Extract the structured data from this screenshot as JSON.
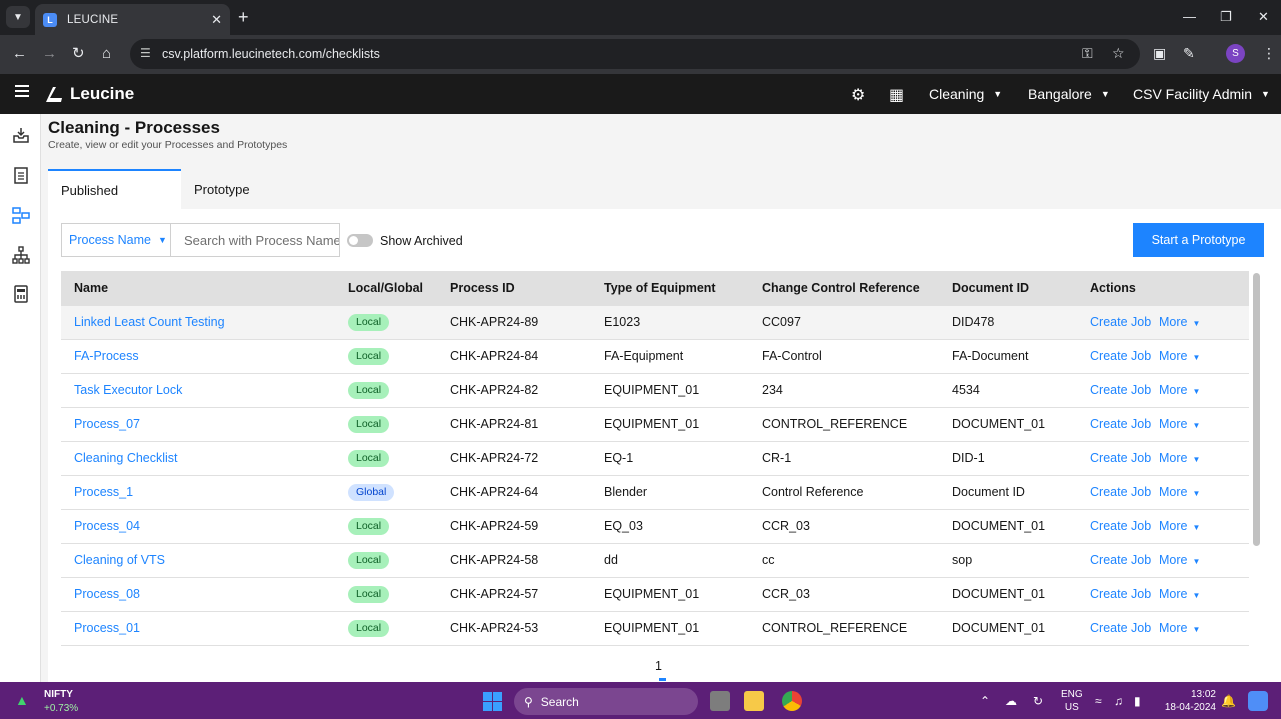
{
  "browser": {
    "tab_title": "LEUCINE",
    "url": "csv.platform.leucinetech.com/checklists",
    "profile_initial": "S"
  },
  "header": {
    "brand": "Leucine",
    "use_case": "Cleaning",
    "site": "Bangalore",
    "role": "CSV Facility Admin"
  },
  "page": {
    "title": "Cleaning - Processes",
    "subtitle": "Create, view or edit your Processes and Prototypes",
    "tabs": [
      {
        "label": "Published",
        "active": true
      },
      {
        "label": "Prototype",
        "active": false
      }
    ]
  },
  "filters": {
    "field_label": "Process Name",
    "search_placeholder": "Search with Process Name",
    "show_archived_label": "Show Archived",
    "show_archived": false,
    "primary_button": "Start a Prototype"
  },
  "table": {
    "columns": [
      "Name",
      "Local/Global",
      "Process ID",
      "Type of Equipment",
      "Change Control Reference",
      "Document ID",
      "Actions"
    ],
    "action_label": "Create Job",
    "more_label": "More",
    "rows": [
      {
        "name": "Linked Least Count Testing",
        "scope": "Local",
        "process_id": "CHK-APR24-89",
        "equipment": "E1023",
        "change_control": "CC097",
        "document_id": "DID478"
      },
      {
        "name": "FA-Process",
        "scope": "Local",
        "process_id": "CHK-APR24-84",
        "equipment": "FA-Equipment",
        "change_control": "FA-Control",
        "document_id": "FA-Document"
      },
      {
        "name": "Task Executor Lock",
        "scope": "Local",
        "process_id": "CHK-APR24-82",
        "equipment": "EQUIPMENT_01",
        "change_control": "234",
        "document_id": "4534"
      },
      {
        "name": "Process_07",
        "scope": "Local",
        "process_id": "CHK-APR24-81",
        "equipment": "EQUIPMENT_01",
        "change_control": "CONTROL_REFERENCE",
        "document_id": "DOCUMENT_01"
      },
      {
        "name": "Cleaning Checklist",
        "scope": "Local",
        "process_id": "CHK-APR24-72",
        "equipment": "EQ-1",
        "change_control": "CR-1",
        "document_id": "DID-1"
      },
      {
        "name": "Process_1",
        "scope": "Global",
        "process_id": "CHK-APR24-64",
        "equipment": "Blender",
        "change_control": "Control Reference",
        "document_id": "Document ID"
      },
      {
        "name": "Process_04",
        "scope": "Local",
        "process_id": "CHK-APR24-59",
        "equipment": "EQ_03",
        "change_control": "CCR_03",
        "document_id": "DOCUMENT_01"
      },
      {
        "name": "Cleaning of VTS",
        "scope": "Local",
        "process_id": "CHK-APR24-58",
        "equipment": "dd",
        "change_control": "cc",
        "document_id": "sop"
      },
      {
        "name": "Process_08",
        "scope": "Local",
        "process_id": "CHK-APR24-57",
        "equipment": "EQUIPMENT_01",
        "change_control": "CCR_03",
        "document_id": "DOCUMENT_01"
      },
      {
        "name": "Process_01",
        "scope": "Local",
        "process_id": "CHK-APR24-53",
        "equipment": "EQUIPMENT_01",
        "change_control": "CONTROL_REFERENCE",
        "document_id": "DOCUMENT_01"
      }
    ]
  },
  "pagination": {
    "current_page": "1"
  },
  "taskbar": {
    "ticker_name": "NIFTY",
    "ticker_change": "+0.73%",
    "search_label": "Search",
    "lang_1": "ENG",
    "lang_2": "US",
    "time": "13:02",
    "date": "18-04-2024"
  },
  "colors": {
    "accent": "#1d84ff",
    "header_bg": "#1a1a1a",
    "local_badge": "#a7f0ba",
    "global_badge": "#d0e2ff",
    "taskbar_bg": "#5c1f77"
  }
}
